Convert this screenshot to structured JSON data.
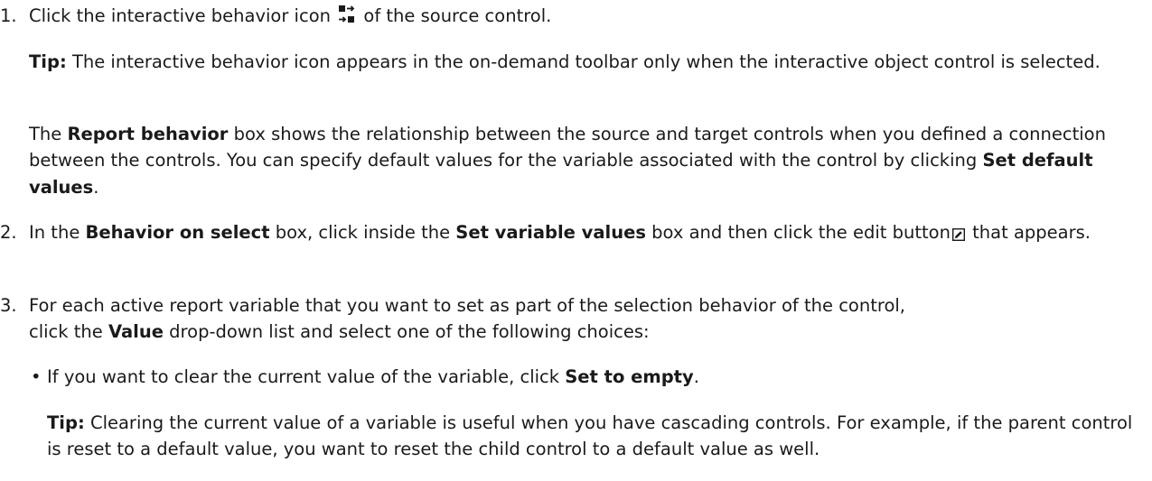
{
  "steps": [
    {
      "number": "1.",
      "text_before_icon": "Click the interactive behavior icon",
      "icon": "interactive-behavior-icon",
      "text_after_icon": "of the source control."
    },
    {
      "number": "2.",
      "t1": "In the ",
      "b1": "Behavior on select",
      "t2": " box, click inside the ",
      "b2": "Set variable values",
      "t3": " box and then click the edit button",
      "icon": "edit-icon",
      "t4": "that appears."
    },
    {
      "number": "3.",
      "t1": "For each active report variable that you want to set as part of the selection behavior of the control,",
      "t2": "click the ",
      "b1": "Value",
      "t3": " drop-down list and select one of the following choices:"
    }
  ],
  "tip1": {
    "label": "Tip:",
    "text": " The interactive behavior icon appears in the on-demand toolbar only when the interactive object control is selected."
  },
  "para1": {
    "t1": "The ",
    "b1": "Report behavior",
    "t2": " box shows the relationship between the source and target controls when you defined a connection between the controls. You can specify default values for the variable associated with the control by clicking ",
    "b2": "Set default values",
    "t3": "."
  },
  "bullet1": {
    "mark": "•",
    "t1": "If you want to clear the current value of the variable, click ",
    "b1": "Set to empty",
    "t2": "."
  },
  "tip2": {
    "label": "Tip:",
    "text": " Clearing the current value of a variable is useful when you have cascading controls. For example, if the parent control is reset to a default value, you want to reset the child control to a default value as well."
  },
  "colors": {
    "text": "#1a1a1a",
    "icon": "#1a1a1a"
  }
}
